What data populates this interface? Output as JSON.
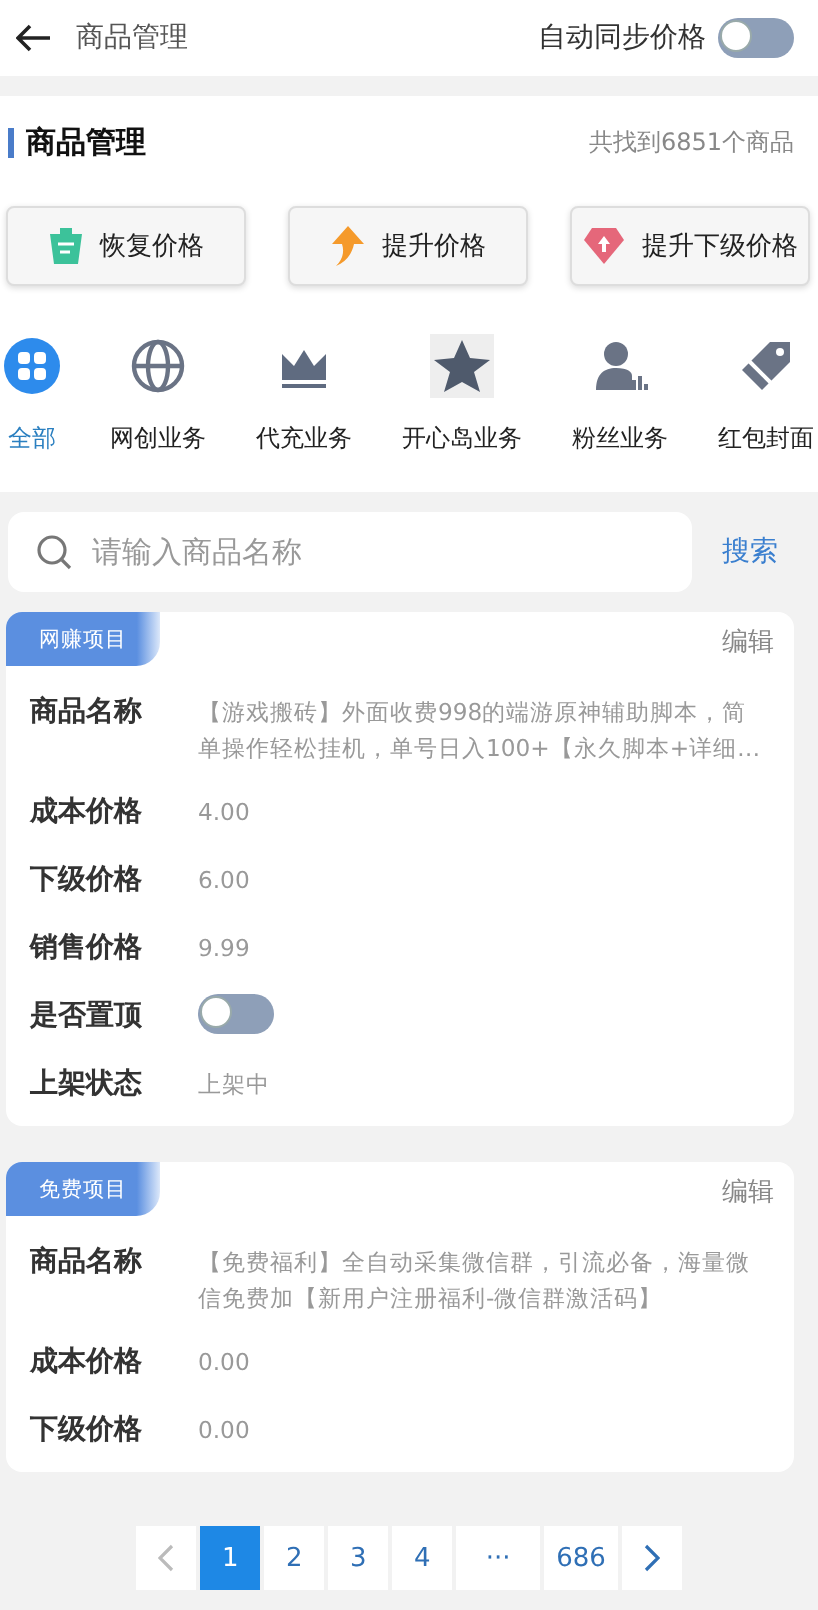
{
  "header": {
    "title": "商品管理",
    "sync_label": "自动同步价格",
    "sync_on": false
  },
  "section": {
    "title": "商品管理",
    "count": "共找到6851个商品"
  },
  "actions": [
    {
      "label": "恢复价格",
      "kind": "trash"
    },
    {
      "label": "提升价格",
      "kind": "up"
    },
    {
      "label": "提升下级价格",
      "kind": "diamond"
    }
  ],
  "categories": [
    {
      "label": "全部",
      "kind": "grid",
      "selected": true
    },
    {
      "label": "网创业务",
      "kind": "globe",
      "selected": false
    },
    {
      "label": "代充业务",
      "kind": "crown",
      "selected": false
    },
    {
      "label": "开心岛业务",
      "kind": "star",
      "selected": false
    },
    {
      "label": "粉丝业务",
      "kind": "person",
      "selected": false
    },
    {
      "label": "红包封面",
      "kind": "tag",
      "selected": false
    }
  ],
  "search": {
    "placeholder": "请输入商品名称",
    "button": "搜索"
  },
  "products": [
    {
      "tag": "网赚项目",
      "edit": "编辑",
      "fields": [
        {
          "kind": "text",
          "label": "商品名称",
          "value": "【游戏搬砖】外面收费998的端游原神辅助脚本，简单操作轻松挂机，单号日入100+【永久脚本+详细…"
        },
        {
          "kind": "text",
          "label": "成本价格",
          "value": "4.00"
        },
        {
          "kind": "text",
          "label": "下级价格",
          "value": "6.00"
        },
        {
          "kind": "text",
          "label": "销售价格",
          "value": "9.99"
        },
        {
          "kind": "toggle",
          "label": "是否置顶",
          "on": false
        },
        {
          "kind": "text",
          "label": "上架状态",
          "value": "上架中"
        }
      ]
    },
    {
      "tag": "免费项目",
      "edit": "编辑",
      "fields": [
        {
          "kind": "text",
          "label": "商品名称",
          "value": "【免费福利】全自动采集微信群，引流必备，海量微信免费加【新用户注册福利-微信群激活码】"
        },
        {
          "kind": "text",
          "label": "成本价格",
          "value": "0.00"
        },
        {
          "kind": "text",
          "label": "下级价格",
          "value": "0.00"
        }
      ]
    }
  ],
  "pagination": [
    {
      "kind": "prev",
      "disabled": true
    },
    {
      "kind": "page",
      "label": "1",
      "selected": true
    },
    {
      "kind": "page",
      "label": "2",
      "selected": false
    },
    {
      "kind": "page",
      "label": "3",
      "selected": false
    },
    {
      "kind": "page",
      "label": "4",
      "selected": false
    },
    {
      "kind": "ellipsis",
      "label": "···"
    },
    {
      "kind": "page",
      "label": "686",
      "selected": false
    },
    {
      "kind": "next",
      "disabled": false
    }
  ]
}
